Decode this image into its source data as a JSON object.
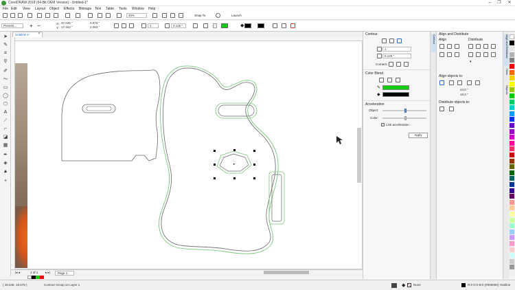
{
  "window": {
    "title": "CorelDRAW 2018 (64-Bit OEM Version) - Untitled-1*",
    "controls": [
      "–",
      "❐",
      "✕"
    ]
  },
  "menu": [
    "File",
    "Edit",
    "View",
    "Layout",
    "Object",
    "Effects",
    "Bitmaps",
    "Text",
    "Table",
    "Tools",
    "Window",
    "Help"
  ],
  "std_toolbar": {
    "zoom": "45%",
    "snap_to": "Snap To",
    "launch": "Launch"
  },
  "prop_bar": {
    "presets": "Presets...",
    "x": "37.045 \"",
    "y": "17.162 \"",
    "w": "0.073 \"",
    "h": "2.063 \"",
    "steps": "1",
    "offset": "0.125 \""
  },
  "document_tab": "Untitled-1*",
  "page_nav": {
    "page_count": "1 of 1",
    "page_tab": "Page 1"
  },
  "contour_panel": {
    "title": "Contour",
    "steps_value": "1",
    "offset_value": "0.125 \"",
    "corners_label": "Corners:",
    "color_blend_label": "Color Blend",
    "acceleration_label": "Acceleration",
    "object_label": "Object:",
    "color_label": "Color:",
    "link_label": "Link acceleration",
    "apply_label": "Apply",
    "object_accel": 0.55,
    "color_accel": 0.55,
    "outline_color": "#11cc11",
    "fill_color": "#000000"
  },
  "align_panel": {
    "title": "Align and Distribute",
    "align_label": "Align",
    "distribute_label": "Distribute",
    "align_to_label": "Align objects to:",
    "x_value": "24.0 \"",
    "y_value": "18.0 \"",
    "distribute_to_label": "Distribute objects to:"
  },
  "side_tabs": [
    "Contour",
    "Align and Distribute",
    "Hints",
    "Objects"
  ],
  "status": {
    "coords": "( 46.548, 19.678 )",
    "description": "Contour Group on Layer 1",
    "fill_none": "None",
    "outline_info": "R:0 G:0 B:0 (#000000)",
    "outline_width": "Hairline"
  },
  "colors": {
    "accent": "#2a6ac9",
    "contour_green": "#7ac77a",
    "guitar_outline": "#666666"
  },
  "palette_colors": [
    "#ffffff",
    "#000000",
    "#e6e6e6",
    "#b3b3b3",
    "#808080",
    "#ff0000",
    "#ff6600",
    "#ffcc00",
    "#ffff00",
    "#99cc00",
    "#00cc00",
    "#00cc66",
    "#00cccc",
    "#0099ff",
    "#0033ff",
    "#6600cc",
    "#9900cc",
    "#cc00cc",
    "#ff0099",
    "#ff3366",
    "#cc0000",
    "#993300",
    "#666600",
    "#006600",
    "#006666",
    "#003399",
    "#330099",
    "#660066",
    "#ff9999",
    "#ffcc99",
    "#ffff99",
    "#ccff99",
    "#99ffcc",
    "#99ccff",
    "#cc99ff",
    "#ff99cc",
    "#ffcccc",
    "#ccffff",
    "#cccccc",
    "#999999"
  ],
  "doc_palette": [
    "#ffffff",
    "#000000",
    "#11cc11",
    "#ff0000"
  ]
}
